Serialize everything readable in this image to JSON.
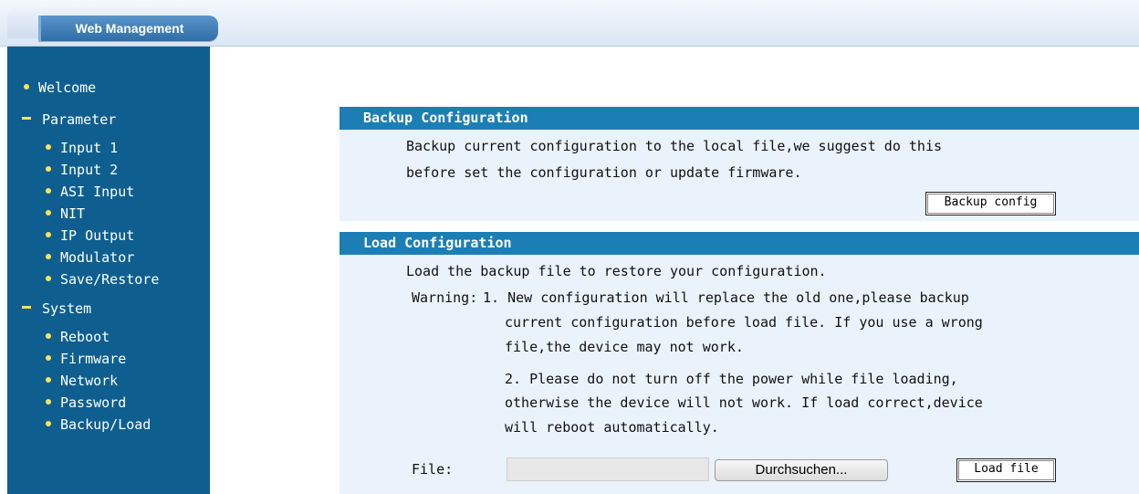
{
  "header": {
    "tab_title": "Web Management"
  },
  "sidebar": {
    "items": [
      {
        "label": "Welcome",
        "type": "item"
      },
      {
        "label": "Parameter",
        "type": "group"
      },
      {
        "label": "Input 1",
        "type": "sub"
      },
      {
        "label": "Input 2",
        "type": "sub"
      },
      {
        "label": "ASI Input",
        "type": "sub"
      },
      {
        "label": "NIT",
        "type": "sub"
      },
      {
        "label": "IP Output",
        "type": "sub"
      },
      {
        "label": "Modulator",
        "type": "sub"
      },
      {
        "label": "Save/Restore",
        "type": "sub"
      },
      {
        "label": "System",
        "type": "group"
      },
      {
        "label": "Reboot",
        "type": "sub"
      },
      {
        "label": "Firmware",
        "type": "sub"
      },
      {
        "label": "Network",
        "type": "sub"
      },
      {
        "label": "Password",
        "type": "sub"
      },
      {
        "label": "Backup/Load",
        "type": "sub"
      }
    ]
  },
  "backup": {
    "title": "Backup Configuration",
    "line1": "Backup current configuration to the local file,we suggest do this",
    "line2": "before set the configuration or update firmware.",
    "button_label": "Backup config"
  },
  "load": {
    "title": "Load Configuration",
    "intro": "Load the backup file to restore your configuration.",
    "warning_label": "Warning:",
    "w1_line1": "1. New configuration will replace the old one,please backup",
    "w1_line2": "current configuration before load file. If you use a wrong",
    "w1_line3": "file,the device may not work.",
    "w2_line1": "2. Please do not turn off the power while file loading,",
    "w2_line2": "otherwise the device will not work. If load correct,device",
    "w2_line3": "will reboot automatically.",
    "file_label": "File:",
    "file_value": "",
    "browse_label": "Durchsuchen...",
    "load_button_label": "Load file"
  },
  "colors": {
    "sidebar_bg": "#0e5f8f",
    "section_header_bg": "#1b7fb5",
    "bullet": "#ffe35a"
  }
}
